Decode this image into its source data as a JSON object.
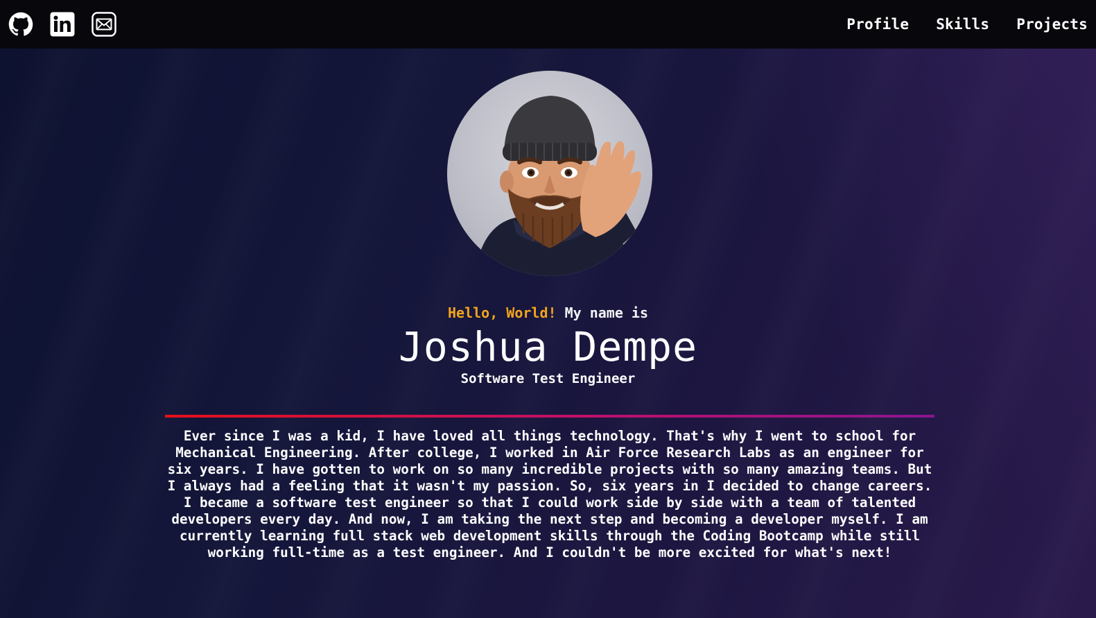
{
  "nav": {
    "social": [
      {
        "name": "github-icon"
      },
      {
        "name": "linkedin-icon"
      },
      {
        "name": "email-icon"
      }
    ],
    "links": [
      "Profile",
      "Skills",
      "Projects"
    ]
  },
  "hero": {
    "greeting_highlight": "Hello, World!",
    "greeting_rest": " My name is",
    "name": "Joshua Dempe",
    "role": "Software Test Engineer",
    "bio": "Ever since I was a kid, I have loved all things technology. That's why I went to school for Mechanical Engineering. After college, I worked in Air Force Research Labs as an engineer for six years. I have gotten to work on so many incredible projects with so many amazing teams. But I always had a feeling that it wasn't my passion. So, six years in I decided to change careers. I became a software test engineer so that I could work side by side with a team of talented developers every day. And now, I am taking the next step and becoming a developer myself. I am currently learning full stack web development skills through the Coding Bootcamp while still working full-time as a test engineer. And I couldn't be more excited for what's next!"
  },
  "colors": {
    "accent": "#f4a51c",
    "divider_start": "#e5101a",
    "divider_end": "#8a1590",
    "nav_bg": "#07070c"
  }
}
